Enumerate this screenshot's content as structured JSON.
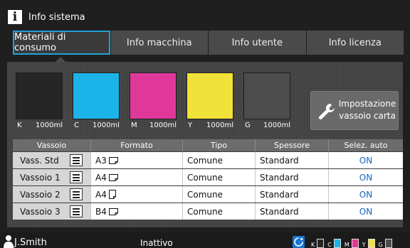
{
  "header": {
    "title": "Info sistema",
    "icon": "info-icon"
  },
  "tabs": [
    {
      "label": "Materiali di consumo",
      "active": true
    },
    {
      "label": "Info macchina",
      "active": false
    },
    {
      "label": "Info utente",
      "active": false
    },
    {
      "label": "Info licenza",
      "active": false
    }
  ],
  "inks": [
    {
      "letter": "K",
      "volume": "1000ml",
      "color": "#262626"
    },
    {
      "letter": "C",
      "volume": "1000ml",
      "color": "#1cb4e8"
    },
    {
      "letter": "M",
      "volume": "1000ml",
      "color": "#e0389a"
    },
    {
      "letter": "Y",
      "volume": "1000ml",
      "color": "#f1e23a"
    },
    {
      "letter": "G",
      "volume": "1000ml",
      "color": "#4d4d4d"
    }
  ],
  "tray_button": {
    "line1": "Impostazione",
    "line2": "vassoio carta",
    "icon": "wrench-icon"
  },
  "table": {
    "headers": [
      "Vassoio",
      "Formato",
      "Tipo",
      "Spessore",
      "Selez. auto"
    ],
    "rows": [
      {
        "tray": "Vass. Std",
        "format": "A3",
        "orientation": "landscape",
        "type": "Comune",
        "thickness": "Standard",
        "auto": "ON"
      },
      {
        "tray": "Vassoio 1",
        "format": "A4",
        "orientation": "landscape",
        "type": "Comune",
        "thickness": "Standard",
        "auto": "ON"
      },
      {
        "tray": "Vassoio 2",
        "format": "A4",
        "orientation": "portrait",
        "type": "Comune",
        "thickness": "Standard",
        "auto": "ON"
      },
      {
        "tray": "Vassoio 3",
        "format": "B4",
        "orientation": "landscape",
        "type": "Comune",
        "thickness": "Standard",
        "auto": "ON"
      }
    ]
  },
  "status": {
    "user": "J.Smith",
    "state": "Inattivo",
    "inks": [
      {
        "letter": "K",
        "color": "#262626"
      },
      {
        "letter": "C",
        "color": "#1cb4e8"
      },
      {
        "letter": "M",
        "color": "#e0389a"
      },
      {
        "letter": "Y",
        "color": "#f1e23a"
      },
      {
        "letter": "G",
        "color": "#4d4d4d"
      }
    ]
  },
  "colors": {
    "accent": "#1fa3d8",
    "on_text": "#1565c0"
  }
}
